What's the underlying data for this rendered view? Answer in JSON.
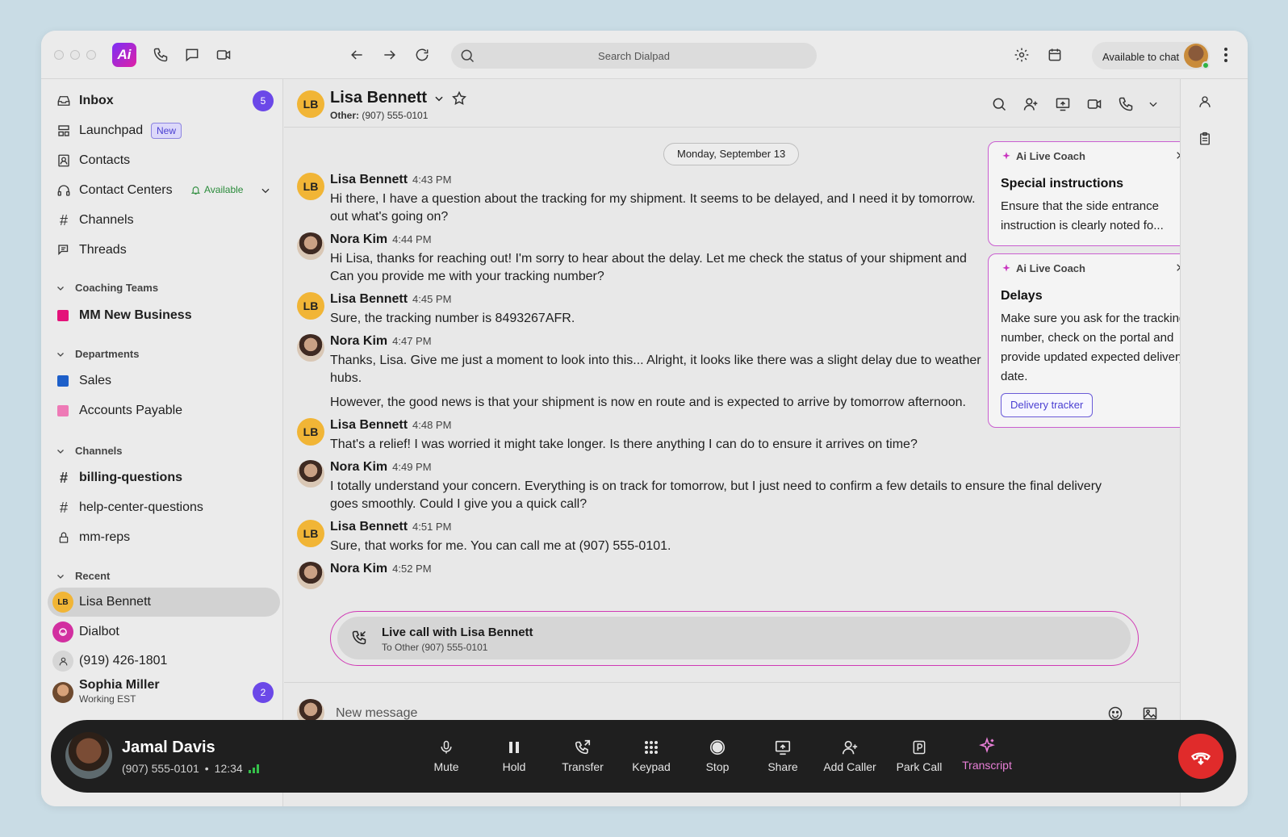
{
  "topbar": {
    "search_placeholder": "Search Dialpad",
    "availability_label": "Available to chat",
    "logo_text": "Ai"
  },
  "sidebar": {
    "inbox": {
      "label": "Inbox",
      "count": "5"
    },
    "launchpad": {
      "label": "Launchpad",
      "badge": "New"
    },
    "contacts": {
      "label": "Contacts"
    },
    "contact_centers": {
      "label": "Contact Centers",
      "status": "Available"
    },
    "channels_nav": {
      "label": "Channels"
    },
    "threads": {
      "label": "Threads"
    },
    "coaching_teams": {
      "header": "Coaching Teams",
      "items": [
        {
          "label": "MM New Business",
          "color": "#e4127a"
        }
      ]
    },
    "departments": {
      "header": "Departments",
      "items": [
        {
          "label": "Sales",
          "color": "#1d5fc9"
        },
        {
          "label": "Accounts Payable",
          "color": "#ee7ab6"
        }
      ]
    },
    "channels": {
      "header": "Channels",
      "items": [
        {
          "label": "billing-questions"
        },
        {
          "label": "help-center-questions"
        },
        {
          "label": "mm-reps"
        }
      ]
    },
    "recent": {
      "header": "Recent",
      "items": [
        {
          "label": "Lisa Bennett",
          "initials": "LB"
        },
        {
          "label": "Dialbot"
        },
        {
          "label": "(919) 426-1801"
        },
        {
          "label": "Sophia Miller",
          "sub": "Working EST",
          "count": "2"
        }
      ]
    }
  },
  "conversation": {
    "contact_name": "Lisa Bennett",
    "contact_initials": "LB",
    "contact_sub_label": "Other:",
    "contact_sub_value": "(907) 555-0101",
    "date_chip": "Monday, September 13",
    "messages": [
      {
        "sender": "Lisa Bennett",
        "time": "4:43 PM",
        "lines": [
          "Hi there, I have a question about the tracking for my shipment. It seems to be delayed, and I need it by tomorrow.",
          "out what's going on?"
        ]
      },
      {
        "sender": "Nora Kim",
        "time": "4:44 PM",
        "lines": [
          "Hi Lisa, thanks for reaching out! I'm sorry to hear about the delay. Let me check the status of your shipment and",
          "Can you provide me with your tracking number?"
        ]
      },
      {
        "sender": "Lisa Bennett",
        "time": "4:45 PM",
        "lines": [
          "Sure, the tracking number is 8493267AFR."
        ]
      },
      {
        "sender": "Nora Kim",
        "time": "4:47 PM",
        "lines": [
          "Thanks, Lisa. Give me just a moment to look into this... Alright, it looks like there was a slight delay due to weather",
          "hubs."
        ],
        "extra": "However, the good news is that your shipment is now en route and is expected to arrive by tomorrow afternoon."
      },
      {
        "sender": "Lisa Bennett",
        "time": "4:48 PM",
        "lines": [
          "That's a relief! I was worried it might take longer. Is there anything I can do to ensure it arrives on time?"
        ]
      },
      {
        "sender": "Nora Kim",
        "time": "4:49 PM",
        "lines": [
          "I totally understand your concern. Everything is on track for tomorrow, but I just need to confirm a few details to ensure the final delivery",
          "goes smoothly. Could I give you a quick call?"
        ]
      },
      {
        "sender": "Lisa Bennett",
        "time": "4:51 PM",
        "lines": [
          "Sure, that works for me. You can call me at (907) 555-0101."
        ]
      },
      {
        "sender": "Nora Kim",
        "time": "4:52 PM",
        "lines": []
      }
    ],
    "live_call": {
      "title": "Live call with Lisa Bennett",
      "subtitle": "To Other (907) 555-0101"
    },
    "composer_placeholder": "New message"
  },
  "coach_cards": [
    {
      "header": "Ai Live Coach",
      "title": "Special instructions",
      "text": "Ensure that the side entrance instruction is clearly noted fo..."
    },
    {
      "header": "Ai Live Coach",
      "title": "Delays",
      "text": "Make sure you ask for the tracking number, check on the portal and provide updated expected delivery date.",
      "button": "Delivery tracker"
    }
  ],
  "call_bar": {
    "name": "Jamal Davis",
    "number": "(907) 555-0101",
    "separator": "•",
    "duration": "12:34",
    "buttons": [
      {
        "label": "Mute"
      },
      {
        "label": "Hold"
      },
      {
        "label": "Transfer"
      },
      {
        "label": "Keypad"
      },
      {
        "label": "Stop"
      },
      {
        "label": "Share"
      },
      {
        "label": "Add Caller"
      },
      {
        "label": "Park Call"
      },
      {
        "label": "Transcript"
      }
    ]
  },
  "colors": {
    "accent": "#6b48e8",
    "coach_border": "#c95fd0",
    "hangup": "#e02b2b",
    "avatar_lb": "#f1b536"
  }
}
